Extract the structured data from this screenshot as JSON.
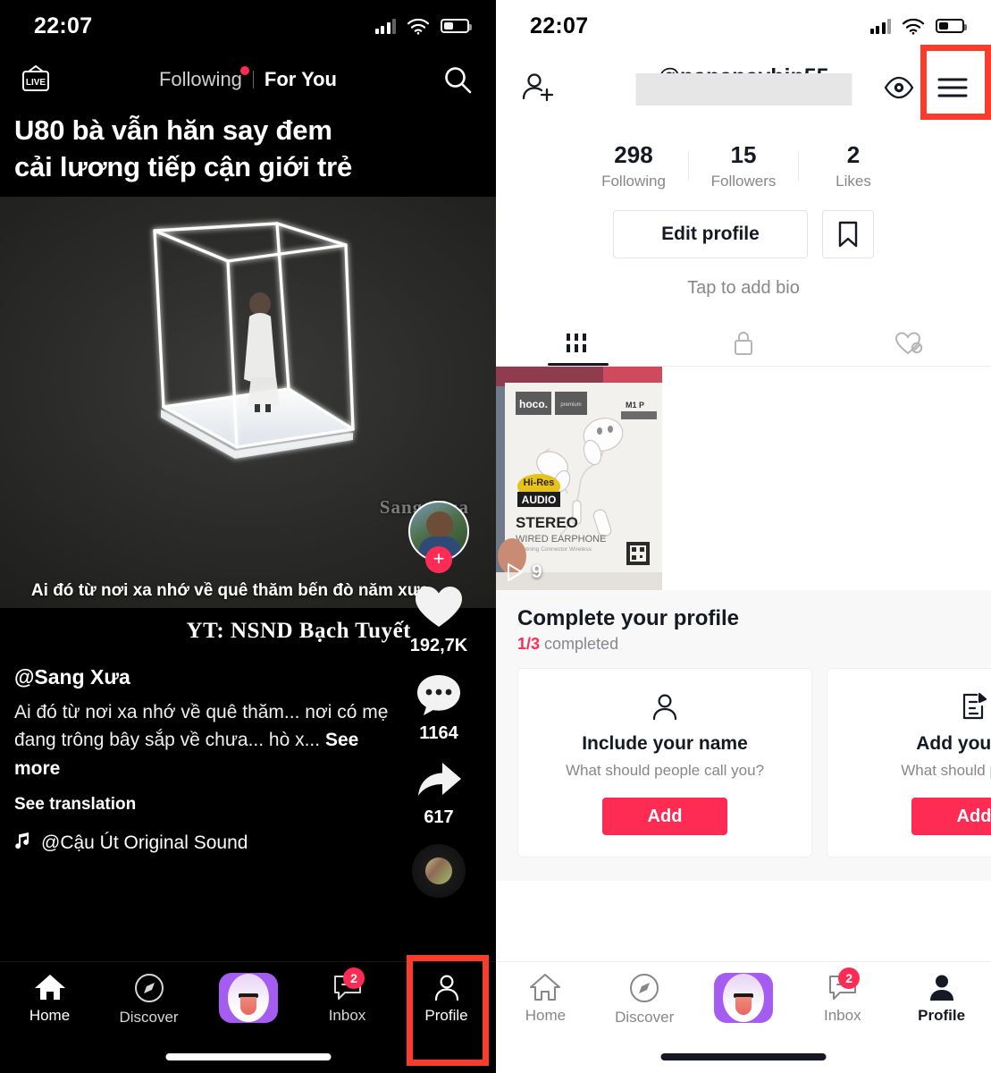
{
  "left_phone": {
    "status": {
      "time": "22:07",
      "signal_icon": "cellular-bars-icon",
      "wifi_icon": "wifi-icon",
      "battery_icon": "battery-low-icon"
    },
    "topnav": {
      "live_label": "LIVE",
      "tabs": [
        {
          "label": "Following",
          "active": false,
          "has_dot": true
        },
        {
          "label": "For You",
          "active": true,
          "has_dot": false
        }
      ],
      "search_icon": "search-icon"
    },
    "video": {
      "title_line1": "U80 bà vẫn hăn say đem",
      "title_line2": "cải lương tiếp cận giới trẻ",
      "watermark": "Sang_Xua",
      "subtitle": "Ai đó từ nơi xa nhớ về quê thăm bến đò năm xưa",
      "credit": "YT: NSND Bạch Tuyết"
    },
    "rail": {
      "avatar_label": "creator-avatar",
      "follow_label": "+",
      "like_icon": "heart-icon",
      "like_count": "192,7K",
      "comment_icon": "comment-icon",
      "comment_count": "1164",
      "share_icon": "share-arrow-icon",
      "share_count": "617",
      "music_disc_label": "music-disc"
    },
    "caption": {
      "username": "@Sang Xưa",
      "text": "Ai đó từ nơi xa nhớ về quê thăm... nơi có mẹ đang trông bây sắp về chưa... hò x...",
      "see_more": "See more",
      "see_translation": "See translation",
      "music_icon": "music-note-icon",
      "music_title": "@Cậu Út Original Sound"
    },
    "tabbar": {
      "items": [
        {
          "label": "Home",
          "icon": "home-icon",
          "active": true,
          "badge": ""
        },
        {
          "label": "Discover",
          "icon": "compass-icon",
          "active": false,
          "badge": ""
        },
        {
          "label": "",
          "icon": "create-icon",
          "active": false,
          "badge": ""
        },
        {
          "label": "Inbox",
          "icon": "inbox-icon",
          "active": false,
          "badge": "2"
        },
        {
          "label": "Profile",
          "icon": "person-icon",
          "active": false,
          "badge": ""
        }
      ]
    },
    "highlight": {
      "target": "Profile",
      "color": "#fa3c2d"
    }
  },
  "right_phone": {
    "status": {
      "time": "22:07",
      "signal_icon": "cellular-bars-icon",
      "wifi_icon": "wifi-icon",
      "battery_icon": "battery-low-icon"
    },
    "topnav": {
      "add_friend_icon": "add-person-icon",
      "username": "@nananayhin55",
      "username_redacted": true,
      "eye_icon": "eye-icon",
      "menu_icon": "hamburger-menu-icon"
    },
    "stats": [
      {
        "value": "298",
        "label": "Following"
      },
      {
        "value": "15",
        "label": "Followers"
      },
      {
        "value": "2",
        "label": "Likes"
      }
    ],
    "actions": {
      "edit_profile": "Edit profile",
      "bookmark_icon": "bookmark-icon",
      "bio_placeholder": "Tap to add bio"
    },
    "tabs": [
      {
        "icon": "grid-icon",
        "active": true
      },
      {
        "icon": "lock-icon",
        "active": false
      },
      {
        "icon": "heart-slash-icon",
        "active": false
      }
    ],
    "grid": {
      "thumbnails": [
        {
          "play_icon": "play-icon",
          "play_count": "9",
          "brand": "hoco.",
          "brand_sub": "premium product",
          "model": "M1 P",
          "badge_top": "Hi-Res",
          "badge_bottom": "AUDIO",
          "title": "STEREO",
          "subtitle": "WIRED EARPHONE",
          "caption": "Lightning Connector Wireless"
        }
      ]
    },
    "complete_profile": {
      "heading": "Complete your profile",
      "progress": "1/3",
      "progress_suffix": " completed",
      "cards": [
        {
          "icon": "person-icon",
          "title": "Include your name",
          "desc": "What should people call you?",
          "button": "Add"
        },
        {
          "icon": "edit-note-icon",
          "title": "Add your bio",
          "desc": "What should people k",
          "button": "Add"
        }
      ]
    },
    "tabbar": {
      "items": [
        {
          "label": "Home",
          "icon": "home-icon",
          "active": false,
          "badge": ""
        },
        {
          "label": "Discover",
          "icon": "compass-icon",
          "active": false,
          "badge": ""
        },
        {
          "label": "",
          "icon": "create-icon",
          "active": false,
          "badge": ""
        },
        {
          "label": "Inbox",
          "icon": "inbox-icon",
          "active": false,
          "badge": "2"
        },
        {
          "label": "Profile",
          "icon": "person-icon",
          "active": true,
          "badge": ""
        }
      ]
    },
    "highlight": {
      "target": "hamburger-menu",
      "color": "#fa3c2d"
    }
  }
}
